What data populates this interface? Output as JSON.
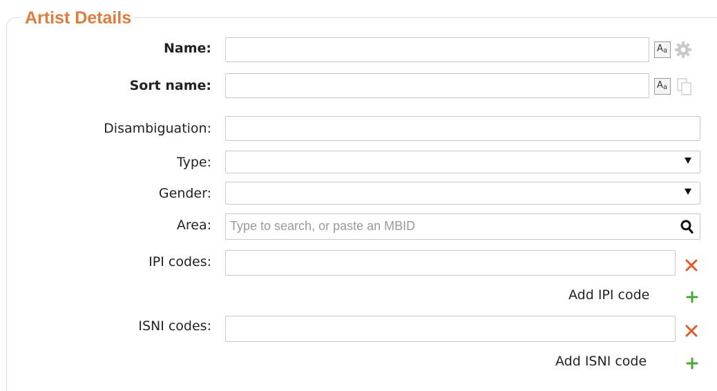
{
  "legend": "Artist Details",
  "labels": {
    "name": "Name:",
    "sort_name": "Sort name:",
    "disambiguation": "Disambiguation:",
    "type": "Type:",
    "gender": "Gender:",
    "area": "Area:",
    "ipi": "IPI codes:",
    "isni": "ISNI codes:"
  },
  "fields": {
    "name_value": "",
    "sort_name_value": "",
    "disambiguation_value": "",
    "type_selected": "",
    "gender_selected": "",
    "area_placeholder": "Type to search, or paste an MBID",
    "ipi_value": "",
    "isni_value": ""
  },
  "buttons": {
    "case_label_large": "A",
    "case_label_small": "a",
    "add_ipi": "Add IPI code",
    "add_isni": "Add ISNI code"
  },
  "icons": {
    "case": "guess-case-icon",
    "gear": "gear-icon",
    "copy": "copy-icon",
    "search": "search-icon",
    "remove": "remove-x-icon",
    "add": "plus-icon"
  },
  "colors": {
    "legend": "#e07b39",
    "remove": "#e8582a",
    "add": "#44a833"
  }
}
